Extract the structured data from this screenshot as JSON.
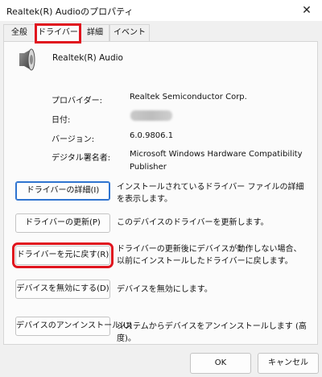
{
  "window": {
    "title": "Realtek(R) Audioのプロパティ",
    "close_glyph": "✕"
  },
  "tabs": [
    "全般",
    "ドライバー",
    "詳細",
    "イベント"
  ],
  "device": {
    "name": "Realtek(R) Audio",
    "icon": "speaker-icon"
  },
  "info": [
    {
      "label": "プロバイダー:",
      "value": "Realtek Semiconductor Corp."
    },
    {
      "label": "日付:",
      "value": ""
    },
    {
      "label": "バージョン:",
      "value": "6.0.9806.1"
    },
    {
      "label": "デジタル署名者:",
      "value": "Microsoft Windows Hardware Compatibility Publisher"
    }
  ],
  "actions": [
    {
      "label": "ドライバーの詳細(I)",
      "desc": "インストールされているドライバー ファイルの詳細を表示します。"
    },
    {
      "label": "ドライバーの更新(P)",
      "desc": "このデバイスのドライバーを更新します。"
    },
    {
      "label": "ドライバーを元に戻す(R)",
      "desc": "ドライバーの更新後にデバイスが動作しない場合、以前にインストールしたドライバーに戻します。"
    },
    {
      "label": "デバイスを無効にする(D)",
      "desc": "デバイスを無効にします。"
    },
    {
      "label": "デバイスのアンインストール(U)",
      "desc": "システムからデバイスをアンインストールします (高度)。"
    }
  ],
  "footer": {
    "ok": "OK",
    "cancel": "キャンセル"
  },
  "colors": {
    "highlight_red": "#e0141e",
    "focus_blue": "#2f74d0"
  }
}
